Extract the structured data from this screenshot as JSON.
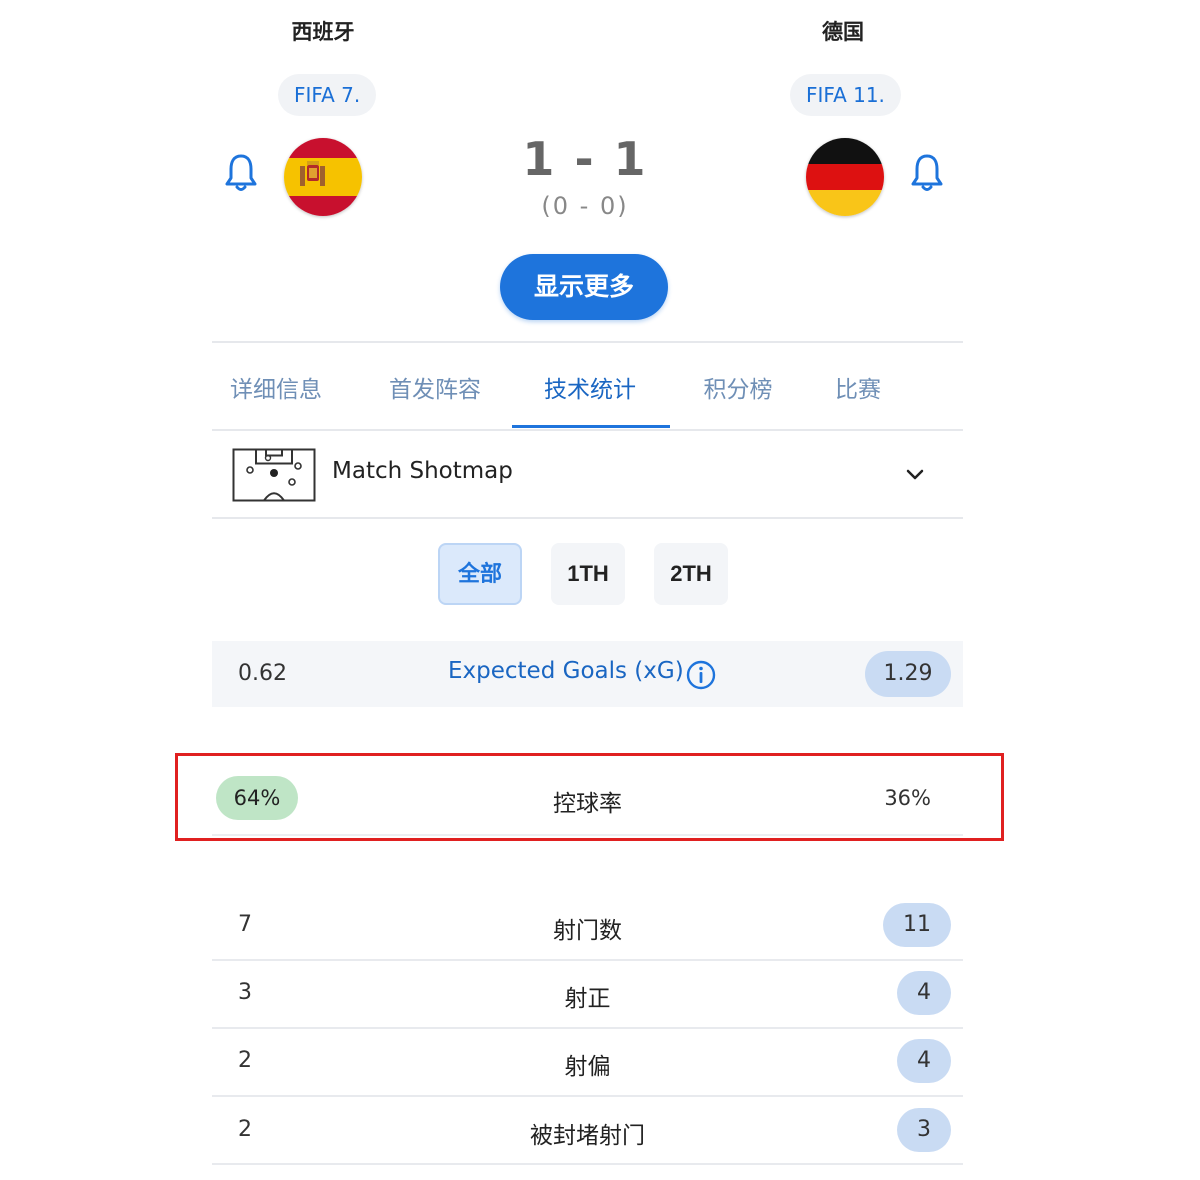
{
  "match": {
    "home": {
      "name": "西班牙",
      "rank": "FIFA 7."
    },
    "away": {
      "name": "德国",
      "rank": "FIFA 11."
    },
    "score": "1 - 1",
    "half_score": "(0 - 0)",
    "show_more_label": "显示更多"
  },
  "tabs": [
    {
      "label": "详细信息"
    },
    {
      "label": "首发阵容"
    },
    {
      "label": "技术统计",
      "active": true
    },
    {
      "label": "积分榜"
    },
    {
      "label": "比赛"
    }
  ],
  "shotmap": {
    "label": "Match Shotmap"
  },
  "periods": [
    {
      "label": "全部",
      "active": true
    },
    {
      "label": "1TH"
    },
    {
      "label": "2TH"
    }
  ],
  "xg": {
    "title": "Expected Goals (xG)",
    "home": "0.62",
    "away": "1.29"
  },
  "possession": {
    "label": "控球率",
    "home": "64%",
    "away": "36%"
  },
  "stats": [
    {
      "label": "射门数",
      "home": "7",
      "away": "11"
    },
    {
      "label": "射正",
      "home": "3",
      "away": "4"
    },
    {
      "label": "射偏",
      "home": "2",
      "away": "4"
    },
    {
      "label": "被封堵射门",
      "home": "2",
      "away": "3"
    }
  ],
  "colors": {
    "accent": "#1e74dc",
    "tab_inactive": "#6f8fb6",
    "pill_blue": "#c9dbf3",
    "pill_green": "#bfe5c6",
    "highlight_border": "#e02020"
  },
  "icons": [
    "bell-icon",
    "spain-flag-icon",
    "germany-flag-icon",
    "pitch-icon",
    "chevron-down-icon",
    "info-icon"
  ]
}
